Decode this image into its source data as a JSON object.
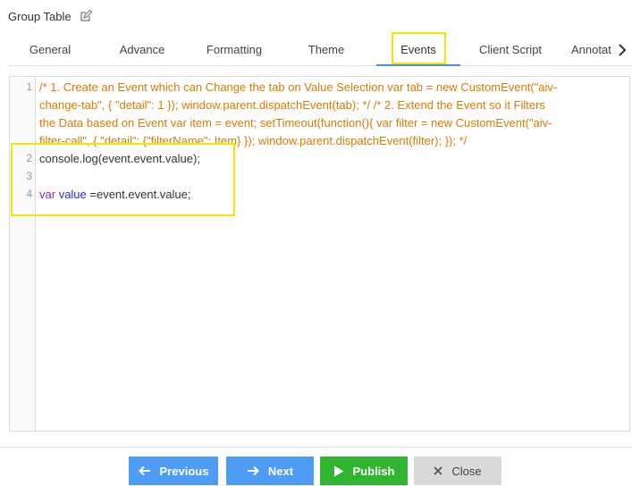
{
  "header": {
    "title": "Group Table",
    "edit_icon": "edit-icon"
  },
  "tabs": [
    {
      "label": "General",
      "active": false
    },
    {
      "label": "Advance",
      "active": false
    },
    {
      "label": "Formatting",
      "active": false
    },
    {
      "label": "Theme",
      "active": false
    },
    {
      "label": "Events",
      "active": true
    },
    {
      "label": "Client Script",
      "active": false
    },
    {
      "label": "Annotat",
      "active": false
    }
  ],
  "editor": {
    "line_numbers": [
      "1",
      "2",
      "3",
      "4"
    ],
    "comment_line_1": "/* 1. Create an Event which can Change the tab on Value Selection var tab = new CustomEvent(\"aiv-",
    "comment_line_2": "change-tab\", {     \"detail\": 1 }); window.parent.dispatchEvent(tab);  */ /* 2. Extend the Event so it Filters",
    "comment_line_3": "the Data based on Event var item = event; setTimeout(function(){ var filter = new CustomEvent(\"aiv-",
    "comment_line_4": "filter-call\", {     \"detail\": {\"filterName\": Item}  });  window.parent.dispatchEvent(filter); }); */",
    "line2": "console.log(event.event.value);",
    "line4_keyword": "var",
    "line4_identifier": "value",
    "line4_rest": " =event.event.value;"
  },
  "footer": {
    "previous_label": "Previous",
    "next_label": "Next",
    "publish_label": "Publish",
    "close_label": "Close"
  },
  "colors": {
    "primary": "#4e9cf5",
    "publish": "#31b531",
    "close": "#dadada",
    "highlight": "#f5e300",
    "comment": "#d97b00"
  }
}
